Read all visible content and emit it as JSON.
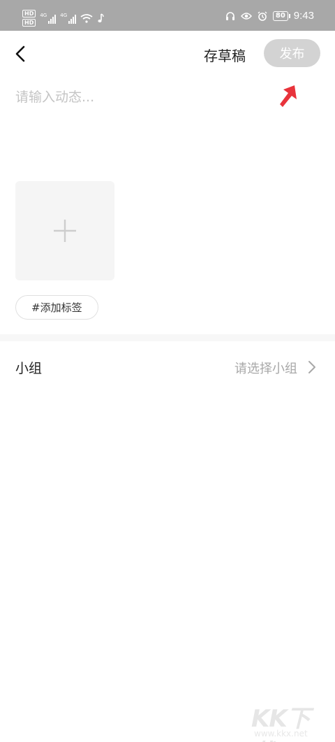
{
  "status_bar": {
    "hd_badge_1": "HD",
    "hd_badge_2": "HD",
    "network_1": "4G",
    "network_2": "4G",
    "battery": "80",
    "time": "9:43",
    "icons": [
      "wifi-icon",
      "music-note-icon",
      "headphones-icon",
      "eye-icon",
      "alarm-icon"
    ]
  },
  "nav": {
    "back_icon": "chevron-left-icon",
    "draft_label": "存草稿",
    "publish_label": "发布"
  },
  "composer": {
    "placeholder": "请输入动态...",
    "value": "",
    "add_image_icon": "plus-icon",
    "add_tag_label": "#添加标签"
  },
  "group": {
    "label": "小组",
    "value": "请选择小组",
    "chevron_icon": "chevron-right-icon"
  },
  "watermark": {
    "logo": "KK下载",
    "url": "www.kkx.net"
  },
  "colors": {
    "status_bar_bg": "#a8a8a8",
    "publish_disabled_bg": "#d3d3d3",
    "annotation_arrow": "#e8333b"
  }
}
